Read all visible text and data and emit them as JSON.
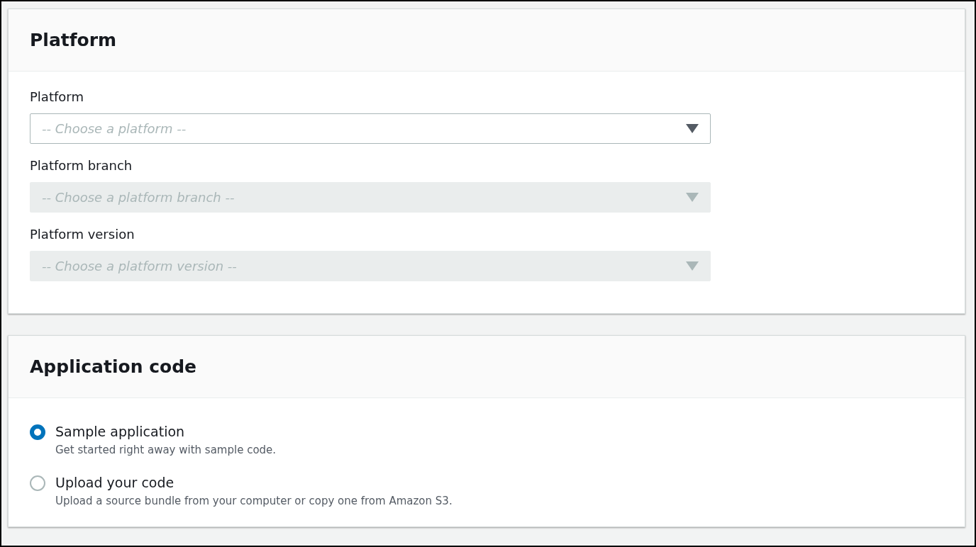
{
  "platform_panel": {
    "title": "Platform",
    "fields": [
      {
        "label": "Platform",
        "placeholder": "-- Choose a platform --",
        "disabled": false
      },
      {
        "label": "Platform branch",
        "placeholder": "-- Choose a platform branch --",
        "disabled": true
      },
      {
        "label": "Platform version",
        "placeholder": "-- Choose a platform version --",
        "disabled": true
      }
    ]
  },
  "application_code_panel": {
    "title": "Application code",
    "options": [
      {
        "label": "Sample application",
        "description": "Get started right away with sample code.",
        "selected": true
      },
      {
        "label": "Upload your code",
        "description": "Upload a source bundle from your computer or copy one from Amazon S3.",
        "selected": false
      }
    ]
  }
}
